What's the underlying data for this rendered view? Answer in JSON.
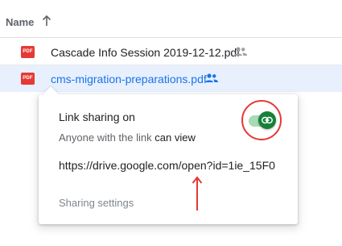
{
  "file_list": {
    "header": {
      "name_label": "Name",
      "sort_icon": "arrow-up-icon"
    },
    "rows": [
      {
        "file_type": "PDF",
        "name": "Cascade Info Session 2019-12-12.pdf",
        "icon": "shared-people-icon",
        "selected": false
      },
      {
        "file_type": "PDF",
        "name": "cms-migration-preparations.pdf",
        "icon": "shared-people-icon",
        "selected": true
      }
    ]
  },
  "share_popup": {
    "title": "Link sharing on",
    "access_who": "Anyone with the link",
    "access_perm": "can view",
    "url": "https://drive.google.com/open?id=1ie_15F0",
    "settings_label": "Sharing settings",
    "toggle": {
      "state": "on",
      "icon": "link-icon"
    }
  },
  "annotations": {
    "highlight_color": "#e53935",
    "arrow_icon": "red-arrow-up-icon"
  },
  "colors": {
    "accent": "#1a73e8",
    "selected_row_bg": "#e8f0fe",
    "toggle_on": "#188038",
    "pdf_red": "#e53935"
  }
}
